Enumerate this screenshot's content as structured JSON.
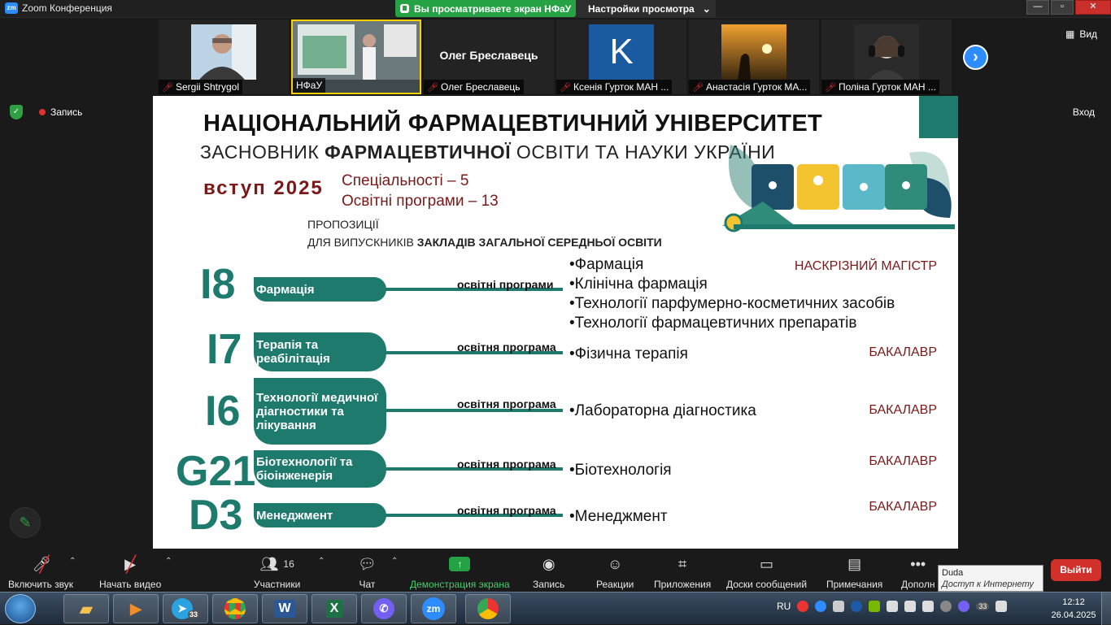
{
  "window": {
    "title": "Zoom Конференция",
    "share_notice": "Вы просматриваете экран НФаУ",
    "view_settings": "Настройки просмотра",
    "minimize": "—",
    "maximize": "▫",
    "close": "✕"
  },
  "participants": [
    {
      "name": "Sergii Shtrygol",
      "muted": true
    },
    {
      "name": "НФаУ",
      "muted": false,
      "active": true
    },
    {
      "name": "Олег Бреславець",
      "muted": true,
      "display_name": "Олег Бреславець"
    },
    {
      "name": "Ксенія Гурток МАН ...",
      "muted": true,
      "avatar_letter": "K"
    },
    {
      "name": "Анастасія Гурток МА...",
      "muted": true
    },
    {
      "name": "Поліна Гурток МАН ...",
      "muted": true
    }
  ],
  "view_button": "Вид",
  "recording_label": "Запись",
  "exit_label": "Вход",
  "slide": {
    "title": "НАЦІОНАЛЬНИЙ ФАРМАЦЕВТИЧНИЙ УНІВЕРСИТЕТ",
    "subtitle_pre": "ЗАСНОВНИК ",
    "subtitle_bold": "ФАРМАЦЕВТИЧНОЇ",
    "subtitle_post": " ОСВІТИ ТА НАУКИ УКРАЇНИ",
    "vstup": "вступ 2025",
    "specialties": "Спеціальності – 5",
    "programs": "Освітні програми – 13",
    "proposals": "ПРОПОЗИЦІЇ",
    "for_grads_pre": "ДЛЯ ВИПУСКНИКІВ ",
    "for_grads_bold": "ЗАКЛАДІВ ЗАГАЛЬНОЇ СЕРЕДНЬОЇ ОСВІТИ",
    "rows": [
      {
        "code": "I8",
        "name": "Фармація",
        "label": "освітні програми",
        "programs": [
          "•Фармація",
          "•Клінічна фармація",
          "•Технології парфумерно-косметичних засобів",
          "•Технології фармацевтичних препаратів"
        ],
        "degree": "НАСКРІЗНИЙ МАГІСТР"
      },
      {
        "code": "I7",
        "name": "Терапія та реабілітація",
        "label": "освітня програма",
        "programs": [
          "•Фізична терапія"
        ],
        "degree": "БАКАЛАВР"
      },
      {
        "code": "I6",
        "name": "Технології медичної діагностики та лікування",
        "label": "освітня програма",
        "programs": [
          "•Лабораторна діагностика"
        ],
        "degree": "БАКАЛАВР"
      },
      {
        "code": "G21",
        "name": "Біотехнології та біоінженерія",
        "label": "освітня програма",
        "programs": [
          "•Біотехнологія"
        ],
        "degree": "БАКАЛАВР"
      },
      {
        "code": "D3",
        "name": "Менеджмент",
        "label": "освітня програма",
        "programs": [
          "•Менеджмент"
        ],
        "degree": "БАКАЛАВР"
      }
    ]
  },
  "toolbar": {
    "mute": "Включить звук",
    "video": "Начать видео",
    "participants": "Участники",
    "participants_count": "16",
    "chat": "Чат",
    "share": "Демонстрация экрана",
    "record": "Запись",
    "reactions": "Реакции",
    "apps": "Приложения",
    "whiteboards": "Доски сообщений",
    "notes": "Примечания",
    "more": "Дополн",
    "leave": "Выйти"
  },
  "tooltip": {
    "title": "Duda",
    "subtitle": "Доступ к Интернету"
  },
  "taskbar": {
    "lang": "RU",
    "time": "12:12",
    "date": "26.04.2025",
    "telegram_badge": "33",
    "zoom_label": "zm",
    "tray_badge": "33"
  },
  "colors": {
    "teal": "#1e7a6d",
    "maroon": "#7b1818",
    "zoom_green": "#25a244",
    "zoom_blue": "#2d8cff",
    "leave_red": "#d1302b"
  }
}
